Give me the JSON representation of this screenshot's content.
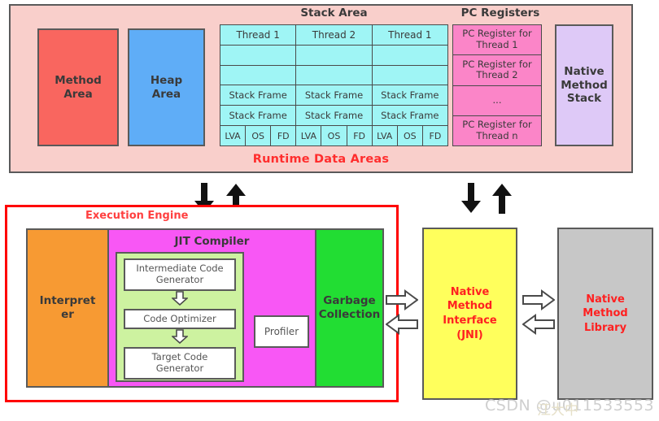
{
  "runtime_data_areas": {
    "caption": "Runtime Data Areas",
    "method_area": "Method\nArea",
    "method_area_line1": "Method",
    "method_area_line2": "Area",
    "heap_area_line1": "Heap",
    "heap_area_line2": "Area",
    "stack_area_label": "Stack Area",
    "stack_threads": [
      {
        "header": "Thread 1",
        "empty_rows": [
          "",
          ""
        ],
        "frames": [
          "Stack Frame",
          "Stack Frame"
        ],
        "parts": [
          "LVA",
          "OS",
          "FD"
        ]
      },
      {
        "header": "Thread 2",
        "empty_rows": [
          "",
          ""
        ],
        "frames": [
          "Stack Frame",
          "Stack Frame"
        ],
        "parts": [
          "LVA",
          "OS",
          "FD"
        ]
      },
      {
        "header": "Thread 1",
        "empty_rows": [
          "",
          ""
        ],
        "frames": [
          "Stack Frame",
          "Stack Frame"
        ],
        "parts": [
          "LVA",
          "OS",
          "FD"
        ]
      }
    ],
    "pc_registers_label": "PC Registers",
    "pc_registers": [
      "PC Register for Thread 1",
      "PC Register for Thread 2",
      "...",
      "PC Register for Thread n"
    ],
    "native_method_stack_line1": "Native",
    "native_method_stack_line2": "Method",
    "native_method_stack_line3": "Stack"
  },
  "execution_engine": {
    "caption": "Execution Engine",
    "interpreter_line1": "Interpret",
    "interpreter_line2": "er",
    "jit_label": "JIT Compiler",
    "jit_stages": [
      "Intermediate Code Generator",
      "Code Optimizer",
      "Target Code Generator"
    ],
    "profiler": "Profiler",
    "garbage_collection_line1": "Garbage",
    "garbage_collection_line2": "Collection"
  },
  "native_method_interface": {
    "line1": "Native",
    "line2": "Method",
    "line3": "Interface",
    "line4": "(JNI)"
  },
  "native_method_library": {
    "line1": "Native",
    "line2": "Method",
    "line3": "Library"
  },
  "watermark": {
    "text": "CSDN @u011533553",
    "overlay": "江大中"
  },
  "colors": {
    "panel_pink": "#f9cfcb",
    "method_area": "#f9665f",
    "heap_area": "#5fadf7",
    "stack_cyan": "#9ff5f5",
    "pc_pink": "#fb85c8",
    "native_stack_lavender": "#dec9f7",
    "interpreter_orange": "#f79a33",
    "jit_magenta": "#f857f5",
    "jit_inner_green": "#cdf2a0",
    "gc_green": "#22dd33",
    "jni_yellow": "#ffff5c",
    "native_lib_gray": "#c7c7c7",
    "accent_red": "#ff0000",
    "caption_red": "#ff2d2d"
  }
}
